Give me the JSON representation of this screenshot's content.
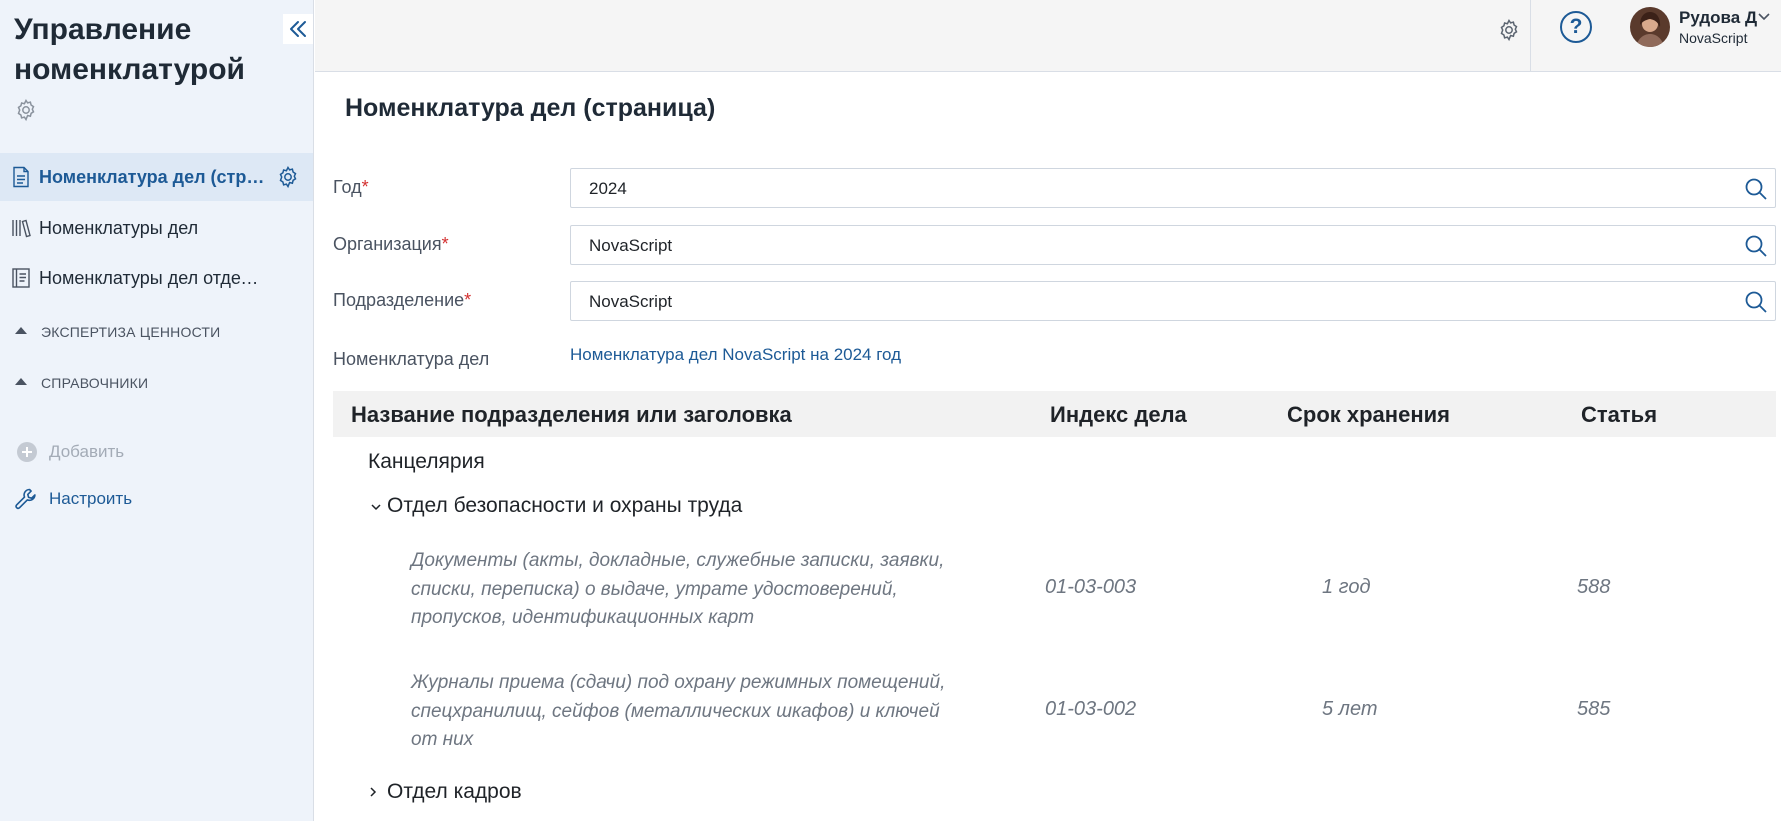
{
  "sidebar": {
    "title": "Управление номенклатурой",
    "items": [
      {
        "label": "Номенклатура дел (страница)",
        "icon": "document-icon",
        "active": true
      },
      {
        "label": "Номенклатуры дел",
        "icon": "books-icon",
        "active": false
      },
      {
        "label": "Номенклатуры дел отделов",
        "icon": "notebook-icon",
        "active": false
      }
    ],
    "groups": [
      {
        "label": "ЭКСПЕРТИЗА ЦЕННОСТИ"
      },
      {
        "label": "СПРАВОЧНИКИ"
      }
    ],
    "add_label": "Добавить",
    "configure_label": "Настроить"
  },
  "topbar": {
    "help_label": "?",
    "user_name": "Рудова Д",
    "user_org": "NovaScript"
  },
  "main": {
    "title": "Номенклатура дел (страница)",
    "fields": [
      {
        "label": "Год",
        "required_mark": "*",
        "value": "2024"
      },
      {
        "label": "Организация",
        "required_mark": "*",
        "value": "NovaScript"
      },
      {
        "label": "Подразделение",
        "required_mark": "*",
        "value": "NovaScript"
      }
    ],
    "nomenclature": {
      "label": "Номенклатура дел",
      "link_text": "Номенклатура дел NovaScript на 2024 год"
    },
    "table": {
      "columns": [
        "Название подразделения или заголовка",
        "Индекс дела",
        "Срок хранения",
        "Статья"
      ],
      "sections": [
        {
          "title": "Канцелярия",
          "expandable": false
        },
        {
          "title": "Отдел безопасности и охраны труда",
          "expandable": true,
          "expanded": true
        },
        {
          "title": "Отдел кадров",
          "expandable": true,
          "expanded": false
        }
      ],
      "rows": [
        {
          "name": "Документы (акты, докладные, служебные записки, заявки, списки, переписка) о выдаче, утрате удостоверений, пропусков, идентификационных карт",
          "index": "01-03-003",
          "term": "1 год",
          "article": "588"
        },
        {
          "name": "Журналы приема (сдачи) под охрану режимных помещений, спецхранилищ, сейфов (металлических шкафов) и ключей от них",
          "index": "01-03-002",
          "term": "5 лет",
          "article": "585"
        }
      ]
    }
  },
  "colors": {
    "accent": "#1d5a96",
    "sidebar_bg": "#eef3fa",
    "required": "#d32f2f",
    "muted_text": "#6e7681"
  }
}
